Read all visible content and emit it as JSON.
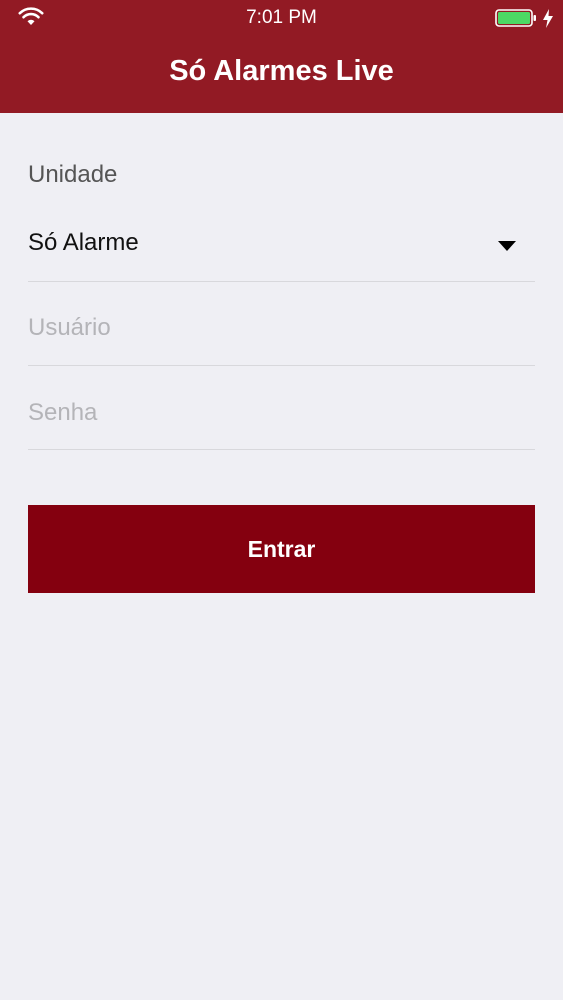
{
  "status_bar": {
    "time": "7:01 PM",
    "wifi_icon": "wifi-icon",
    "battery_icon": "battery-icon",
    "charging_icon": "lightning-bolt-icon",
    "battery_color": "#4cd964"
  },
  "header": {
    "title": "Só Alarmes Live",
    "background": "#921a24"
  },
  "form": {
    "unit_label": "Unidade",
    "unit_selected": "Só Alarme",
    "dropdown_icon": "caret-down-icon",
    "username": {
      "value": "",
      "placeholder": "Usuário"
    },
    "password": {
      "value": "",
      "placeholder": "Senha"
    },
    "submit_label": "Entrar",
    "submit_color": "#84000f"
  }
}
